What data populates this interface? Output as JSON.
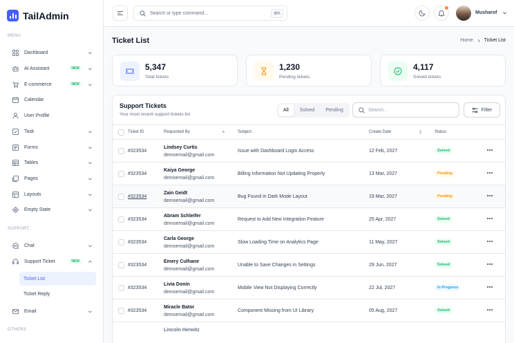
{
  "brand": {
    "name": "TailAdmin"
  },
  "sidebar": {
    "menu_label": "MENU",
    "support_label": "SUPPORT",
    "others_label": "OTHERS",
    "items": [
      {
        "label": "Dashboard",
        "badge": ""
      },
      {
        "label": "AI Assistant",
        "badge": "NEW"
      },
      {
        "label": "E-commerce",
        "badge": "NEW"
      },
      {
        "label": "Calendar",
        "badge": ""
      },
      {
        "label": "User Profile",
        "badge": ""
      },
      {
        "label": "Task",
        "badge": ""
      },
      {
        "label": "Forms",
        "badge": ""
      },
      {
        "label": "Tables",
        "badge": ""
      },
      {
        "label": "Pages",
        "badge": ""
      },
      {
        "label": "Layouts",
        "badge": ""
      },
      {
        "label": "Empty State",
        "badge": ""
      }
    ],
    "support_items": [
      {
        "label": "Chat",
        "badge": ""
      },
      {
        "label": "Support Ticket",
        "badge": "NEW"
      }
    ],
    "sub_items": [
      {
        "label": "Ticket List",
        "active": true
      },
      {
        "label": "Ticket Reply",
        "active": false
      }
    ],
    "email_label": "Email"
  },
  "header": {
    "search_placeholder": "Search or type command...",
    "shortcut": "⌘K",
    "user_name": "Musharof"
  },
  "page": {
    "title": "Ticket List",
    "breadcrumb_home": "Home",
    "breadcrumb_current": "Ticket List"
  },
  "stats": [
    {
      "value": "5,347",
      "label": "Total tickets",
      "color": "#465fff",
      "bg": "#ecf3ff"
    },
    {
      "value": "1,230",
      "label": "Pending tickets",
      "color": "#f79009",
      "bg": "#fffaeb"
    },
    {
      "value": "4,117",
      "label": "Solved tickets",
      "color": "#12b76a",
      "bg": "#ecfdf3"
    }
  ],
  "table": {
    "title": "Support Tickets",
    "subtitle": "Your most recent support tickets list",
    "filters": [
      "All",
      "Solved",
      "Pending"
    ],
    "active_filter": "All",
    "search_placeholder": "Search...",
    "filter_label": "Filter",
    "columns": [
      "Ticket ID",
      "Requested By",
      "Subject",
      "Create Date",
      "Status"
    ],
    "rows": [
      {
        "id": "#323534",
        "name": "Lindsey Curtis",
        "email": "demoemail@gmail.com",
        "subject": "Issue with Dashboard Login Access",
        "date": "12 Feb, 2027",
        "status": "Solved"
      },
      {
        "id": "#323534",
        "name": "Kaiya George",
        "email": "demoemail@gmail.com",
        "subject": "Billing Information Not Updating Properly",
        "date": "13 Mar, 2027",
        "status": "Pending"
      },
      {
        "id": "#323534",
        "name": "Zain Geidt",
        "email": "demoemail@gmail.com",
        "subject": "Bug Found in Dark Mode Layout",
        "date": "19 Mar, 2027",
        "status": "Pending"
      },
      {
        "id": "#323534",
        "name": "Abram Schleifer",
        "email": "demoemail@gmail.com",
        "subject": "Request to Add New Integration Feature",
        "date": "25 Apr, 2027",
        "status": "Solved"
      },
      {
        "id": "#323534",
        "name": "Carla George",
        "email": "demoemail@gmail.com",
        "subject": "Slow Loading Time on Analytics Page",
        "date": "11 May, 2027",
        "status": "Solved"
      },
      {
        "id": "#323534",
        "name": "Emery Culhane",
        "email": "demoemail@gmail.com",
        "subject": "Unable to Save Changes in Settings",
        "date": "29 Jun, 2027",
        "status": "Solved"
      },
      {
        "id": "#323534",
        "name": "Livia Donin",
        "email": "demoemail@gmail.com",
        "subject": "Mobile View Not Displaying Correctly",
        "date": "22 Jul, 2027",
        "status": "In Progress"
      },
      {
        "id": "#323534",
        "name": "Miracle Bator",
        "email": "demoemail@gmail.com",
        "subject": "Component Missing from UI Library",
        "date": "05 Aug, 2027",
        "status": "Solved"
      },
      {
        "id": "",
        "name": "Lincoln Herwitz",
        "email": "",
        "subject": "",
        "date": "",
        "status": ""
      }
    ]
  }
}
